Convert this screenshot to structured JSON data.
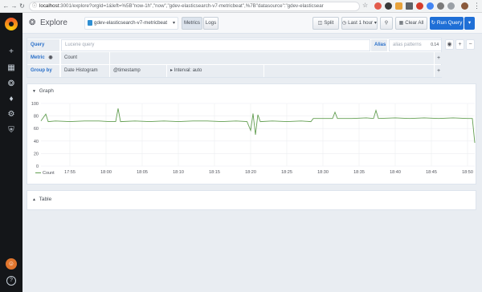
{
  "browser": {
    "url_host": "localhost",
    "url_rest": ":3001/explore?orgId=1&left=%5B\"now-1h\",\"now\",\"gdev-elasticsearch-v7-metricbeat\",%7B\"datasource\":\"gdev-elasticsear"
  },
  "navbar": {
    "title": "Explore",
    "datasource": "gdev-elasticsearch-v7-metricbeat",
    "mode_metrics": "Metrics",
    "mode_logs": "Logs",
    "split_label": "Split",
    "time_range": "Last 1 hour",
    "clear_all": "Clear All",
    "run_query": "Run Query"
  },
  "query": {
    "query_label": "Query",
    "query_placeholder": "Lucene query",
    "alias_label": "Alias",
    "alias_placeholder": "alias patterns",
    "alias_value": "0.14",
    "metric_label": "Metric",
    "metric_value": "Count",
    "group_label": "Group by",
    "group_type": "Date Histogram",
    "group_field": "@timestamp",
    "interval": "Interval: auto"
  },
  "graph": {
    "title": "Graph",
    "legend": "Count"
  },
  "table": {
    "title": "Table"
  },
  "colors": {
    "series": "#629e51",
    "run_button": "#1f6fd6",
    "sidebar": "#141619"
  },
  "chart_data": {
    "type": "line",
    "ylim": [
      0,
      100
    ],
    "yticks": [
      0,
      20,
      40,
      60,
      80,
      100
    ],
    "xlim": [
      "17:51",
      "18:51"
    ],
    "xticks": [
      "17:55",
      "18:00",
      "18:05",
      "18:10",
      "18:15",
      "18:20",
      "18:25",
      "18:30",
      "18:35",
      "18:40",
      "18:45",
      "18:50"
    ],
    "series": [
      {
        "name": "Count",
        "color": "#629e51",
        "points": [
          [
            "17:51:00",
            72
          ],
          [
            "17:51:40",
            83
          ],
          [
            "17:52:00",
            71
          ],
          [
            "17:53:00",
            72
          ],
          [
            "17:55:00",
            71
          ],
          [
            "17:57:00",
            72
          ],
          [
            "17:59:00",
            72
          ],
          [
            "18:00:30",
            71
          ],
          [
            "18:01:20",
            71
          ],
          [
            "18:01:40",
            92
          ],
          [
            "18:02:00",
            71
          ],
          [
            "18:04:00",
            72
          ],
          [
            "18:06:00",
            71
          ],
          [
            "18:08:00",
            72
          ],
          [
            "18:10:00",
            71
          ],
          [
            "18:12:00",
            72
          ],
          [
            "18:14:00",
            72
          ],
          [
            "18:16:00",
            71
          ],
          [
            "18:18:00",
            72
          ],
          [
            "18:19:30",
            71
          ],
          [
            "18:20:00",
            57
          ],
          [
            "18:20:20",
            84
          ],
          [
            "18:20:40",
            50
          ],
          [
            "18:21:00",
            82
          ],
          [
            "18:21:20",
            71
          ],
          [
            "18:23:00",
            72
          ],
          [
            "18:25:00",
            71
          ],
          [
            "18:27:00",
            72
          ],
          [
            "18:28:20",
            71
          ],
          [
            "18:28:40",
            76
          ],
          [
            "18:30:00",
            76
          ],
          [
            "18:31:20",
            76
          ],
          [
            "18:31:40",
            86
          ],
          [
            "18:32:00",
            76
          ],
          [
            "18:34:00",
            76
          ],
          [
            "18:36:00",
            77
          ],
          [
            "18:37:00",
            76
          ],
          [
            "18:37:20",
            89
          ],
          [
            "18:37:40",
            76
          ],
          [
            "18:40:00",
            77
          ],
          [
            "18:42:00",
            76
          ],
          [
            "18:44:00",
            77
          ],
          [
            "18:46:00",
            76
          ],
          [
            "18:48:00",
            77
          ],
          [
            "18:50:00",
            76
          ],
          [
            "18:50:40",
            76
          ],
          [
            "18:51:00",
            37
          ]
        ]
      }
    ],
    "legend_placement": "bottom-left",
    "grid": true
  }
}
